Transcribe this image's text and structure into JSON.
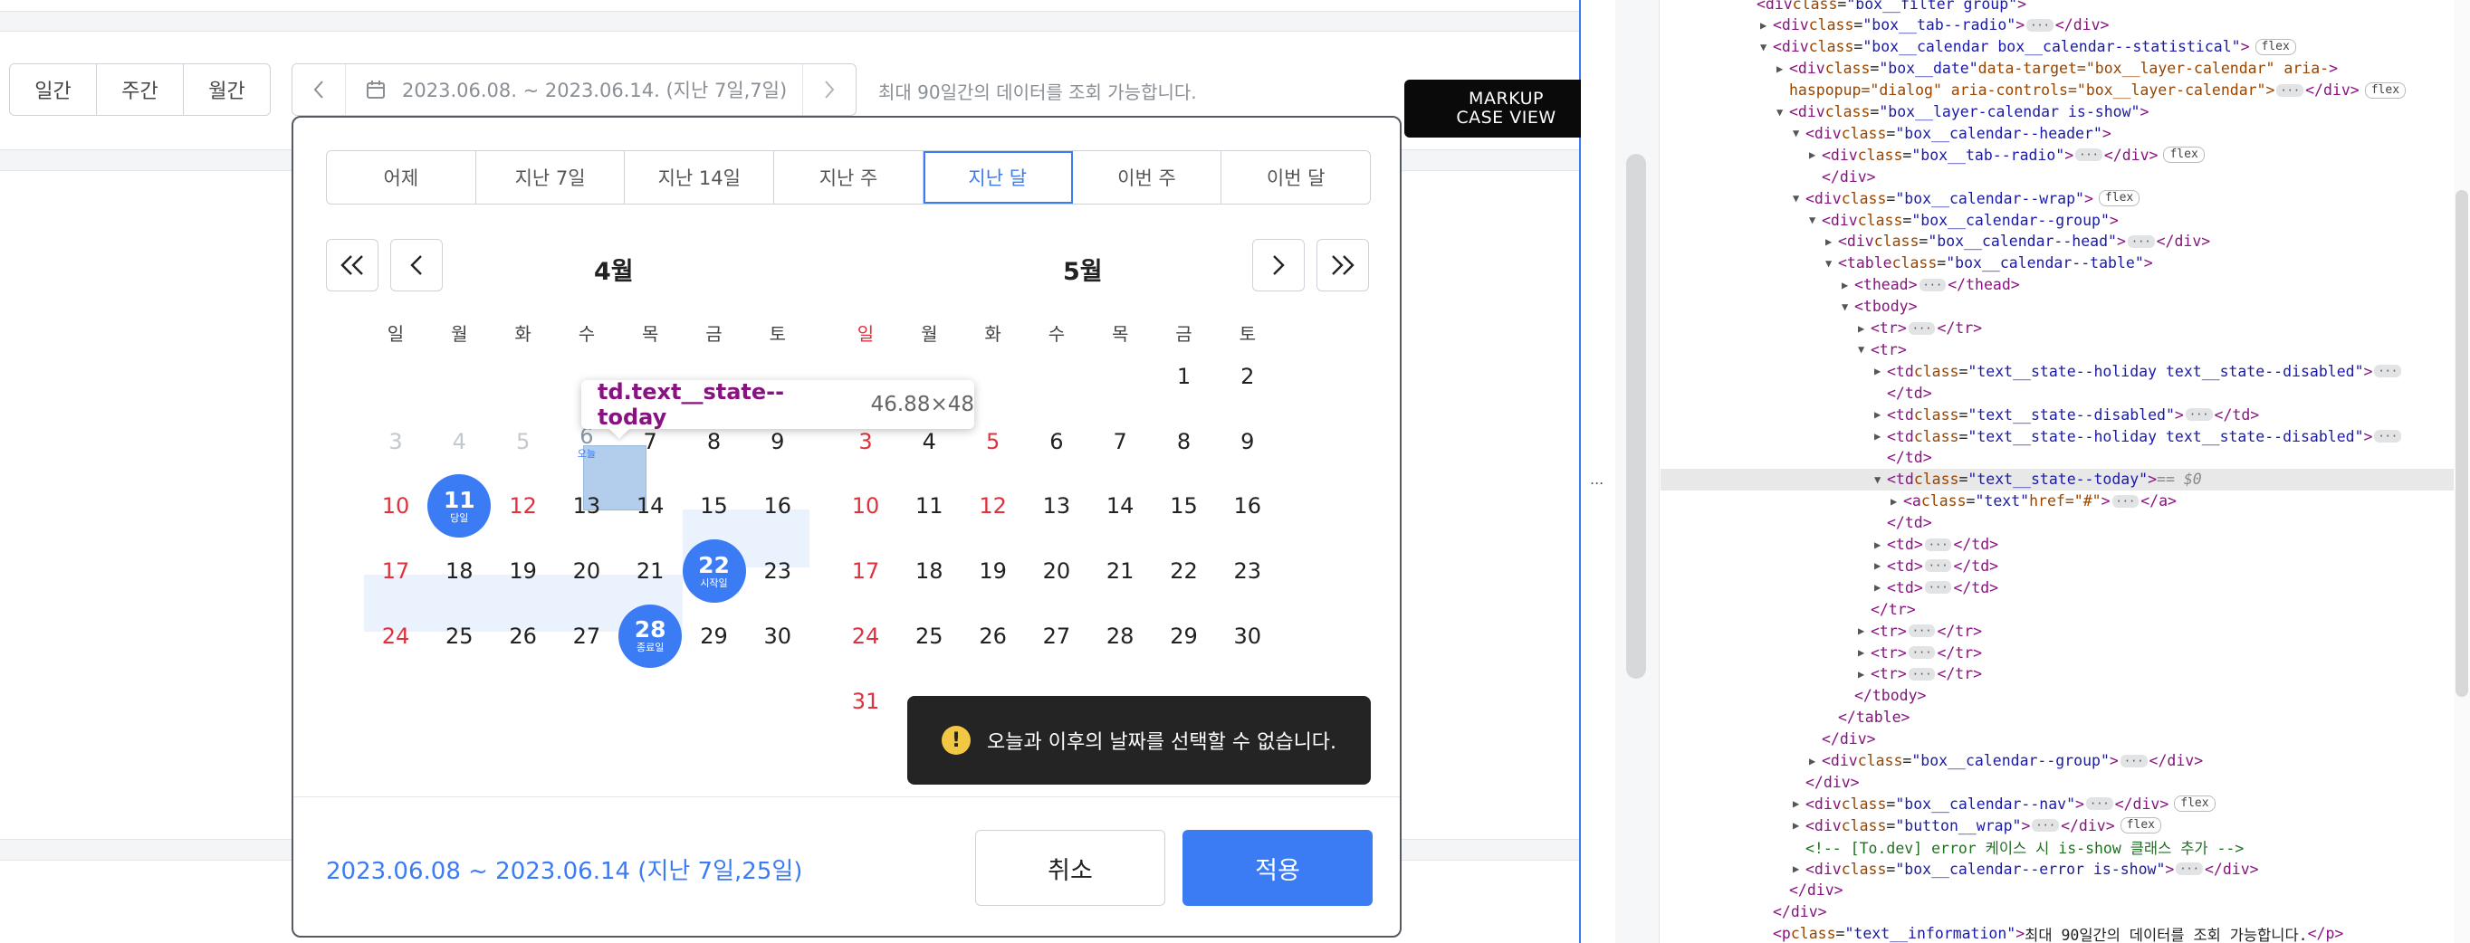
{
  "period_tabs": [
    "일간",
    "주간",
    "월간"
  ],
  "date_field": {
    "value": "2023.06.08. ~ 2023.06.14. (지난 7일,7일)"
  },
  "info_text": "최대 90일간의 데이터를 조회 가능합니다.",
  "markup_badge": {
    "line1": "MARKUP",
    "line2": "CASE VIEW"
  },
  "quick_tabs": [
    {
      "label": "어제",
      "active": false
    },
    {
      "label": "지난 7일",
      "active": false
    },
    {
      "label": "지난 14일",
      "active": false
    },
    {
      "label": "지난 주",
      "active": false
    },
    {
      "label": "지난 달",
      "active": true
    },
    {
      "label": "이번 주",
      "active": false
    },
    {
      "label": "이번 달",
      "active": false
    }
  ],
  "calendar_left": {
    "title": "4월",
    "weekdays": [
      "일",
      "월",
      "화",
      "수",
      "목",
      "금",
      "토"
    ],
    "weeks": [
      [
        "",
        "",
        "",
        "",
        "",
        "",
        ""
      ],
      [
        "3",
        "4",
        "5",
        "6",
        "7",
        "8",
        "9"
      ],
      [
        "10",
        "11",
        "12",
        "13",
        "14",
        "15",
        "16"
      ],
      [
        "17",
        "18",
        "19",
        "20",
        "21",
        "22",
        "23"
      ],
      [
        "24",
        "25",
        "26",
        "27",
        "28",
        "29",
        "30"
      ]
    ],
    "today_label": "오늘",
    "marked": [
      {
        "day": "11",
        "label": "당일"
      },
      {
        "day": "22",
        "label": "시작일"
      },
      {
        "day": "28",
        "label": "종료일"
      }
    ]
  },
  "calendar_right": {
    "title": "5월",
    "weekdays": [
      "일",
      "월",
      "화",
      "수",
      "목",
      "금",
      "토"
    ],
    "weeks": [
      [
        "",
        "",
        "",
        "",
        "",
        "1",
        "2"
      ],
      [
        "3",
        "4",
        "5",
        "6",
        "7",
        "8",
        "9"
      ],
      [
        "10",
        "11",
        "12",
        "13",
        "14",
        "15",
        "16"
      ],
      [
        "17",
        "18",
        "19",
        "20",
        "21",
        "22",
        "23"
      ],
      [
        "24",
        "25",
        "26",
        "27",
        "28",
        "29",
        "30"
      ],
      [
        "31",
        "",
        "",
        "",
        "",
        "",
        ""
      ]
    ]
  },
  "tooltip": {
    "selector": "td.text__state--today",
    "dims": "46.88×48"
  },
  "toast": {
    "icon": "!",
    "message": "오늘과 이후의 날짜를 선택할 수 없습니다."
  },
  "footer": {
    "range_text": "2023.06.08 ~ 2023.06.14 (지난 7일,25일)",
    "cancel": "취소",
    "apply": "적용"
  },
  "devtools": {
    "ellipsis": "...",
    "lines": [
      {
        "indent": 0,
        "html": "<span class='tag'>&lt;div</span> <span class='attr'>class</span>=<span class='val'>\"box__filter group\"</span><span class='tag'>&gt;</span>"
      },
      {
        "indent": 1,
        "caret": "▶",
        "tag_open": "div",
        "cls": "box__tab--radio",
        "dots": true,
        "close": "div"
      },
      {
        "indent": 1,
        "caret": "▼",
        "tag_open": "div",
        "cls": "box__calendar box__calendar--statistical",
        "flex": true
      },
      {
        "indent": 2,
        "caret": "▶",
        "tag_open": "div",
        "cls": "box__date",
        "extra": " data-target=\"box__layer-calendar\" aria-"
      },
      {
        "indent": 2,
        "raw": "haspopup=\"dialog\" aria-controls=\"box__layer-calendar\"&gt;",
        "dots": true,
        "close": "div",
        "flex": true
      },
      {
        "indent": 2,
        "caret": "▼",
        "tag_open": "div",
        "cls": "box__layer-calendar is-show"
      },
      {
        "indent": 3,
        "caret": "▼",
        "tag_open": "div",
        "cls": "box__calendar--header"
      },
      {
        "indent": 4,
        "caret": "▶",
        "tag_open": "div",
        "cls": "box__tab--radio",
        "dots": true,
        "close": "div",
        "flex": true
      },
      {
        "indent": 4,
        "close_only": "div"
      },
      {
        "indent": 3,
        "caret": "▼",
        "tag_open": "div",
        "cls": "box__calendar--wrap",
        "flex": true
      },
      {
        "indent": 4,
        "caret": "▼",
        "tag_open": "div",
        "cls": "box__calendar--group"
      },
      {
        "indent": 5,
        "caret": "▶",
        "tag_open": "div",
        "cls": "box__calendar--head",
        "dots": true,
        "close": "div"
      },
      {
        "indent": 5,
        "caret": "▼",
        "tag_open": "table",
        "cls": "box__calendar--table"
      },
      {
        "indent": 6,
        "caret": "▶",
        "tag_open": "thead",
        "dots": true,
        "close": "thead"
      },
      {
        "indent": 6,
        "caret": "▼",
        "tag_open": "tbody"
      },
      {
        "indent": 7,
        "caret": "▶",
        "tag_open": "tr",
        "dots": true,
        "close": "tr"
      },
      {
        "indent": 7,
        "caret": "▼",
        "tag_open": "tr"
      },
      {
        "indent": 8,
        "caret": "▶",
        "tag_open": "td",
        "cls": "text__state--holiday text__state--disabled",
        "dots": true
      },
      {
        "indent": 8,
        "close_only": "td"
      },
      {
        "indent": 8,
        "caret": "▶",
        "tag_open": "td",
        "cls": "text__state--disabled",
        "dots": true,
        "close": "td"
      },
      {
        "indent": 8,
        "caret": "▶",
        "tag_open": "td",
        "cls": "text__state--holiday text__state--disabled",
        "dots": true
      },
      {
        "indent": 8,
        "close_only": "td"
      },
      {
        "indent": 8,
        "caret": "▼",
        "tag_open": "td",
        "cls": "text__state--today",
        "selected": " == $0",
        "hl": true
      },
      {
        "indent": 9,
        "caret": "▶",
        "tag_open": "a",
        "cls": "text",
        "extra": " href=\"#\"",
        "dots": true,
        "close": "a"
      },
      {
        "indent": 8,
        "close_only": "td"
      },
      {
        "indent": 8,
        "caret": "▶",
        "tag_open": "td",
        "dots": true,
        "close": "td"
      },
      {
        "indent": 8,
        "caret": "▶",
        "tag_open": "td",
        "dots": true,
        "close": "td"
      },
      {
        "indent": 8,
        "caret": "▶",
        "tag_open": "td",
        "dots": true,
        "close": "td"
      },
      {
        "indent": 7,
        "close_only": "tr"
      },
      {
        "indent": 7,
        "caret": "▶",
        "tag_open": "tr",
        "dots": true,
        "close": "tr"
      },
      {
        "indent": 7,
        "caret": "▶",
        "tag_open": "tr",
        "dots": true,
        "close": "tr"
      },
      {
        "indent": 7,
        "caret": "▶",
        "tag_open": "tr",
        "dots": true,
        "close": "tr"
      },
      {
        "indent": 6,
        "close_only": "tbody"
      },
      {
        "indent": 5,
        "close_only": "table"
      },
      {
        "indent": 4,
        "close_only": "div"
      },
      {
        "indent": 4,
        "caret": "▶",
        "tag_open": "div",
        "cls": "box__calendar--group",
        "dots": true,
        "close": "div"
      },
      {
        "indent": 3,
        "close_only": "div"
      },
      {
        "indent": 3,
        "caret": "▶",
        "tag_open": "div",
        "cls": "box__calendar--nav",
        "dots": true,
        "close": "div",
        "flex": true
      },
      {
        "indent": 3,
        "caret": "▶",
        "tag_open": "div",
        "cls": "button__wrap",
        "dots": true,
        "close": "div",
        "flex": true
      },
      {
        "indent": 3,
        "comment": "&lt;!-- [To.dev] error 케이스 시 is-show 클래스 추가 --&gt;"
      },
      {
        "indent": 3,
        "caret": "▶",
        "tag_open": "div",
        "cls": "box__calendar--error is-show",
        "dots": true,
        "close": "div"
      },
      {
        "indent": 2,
        "close_only": "div"
      },
      {
        "indent": 1,
        "close_only": "div"
      },
      {
        "indent": 1,
        "tag_open": "p",
        "cls": "text__information",
        "text": "최대 90일간의 데이터를 조회 가능합니다.",
        "close": "p"
      }
    ]
  }
}
